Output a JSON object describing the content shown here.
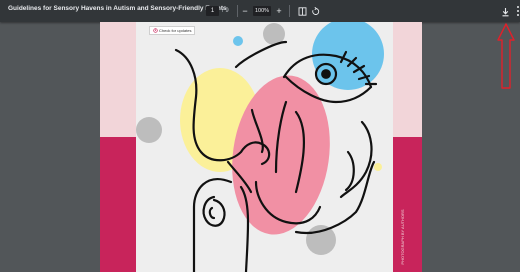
{
  "toolbar": {
    "document_title": "Guidelines for Sensory Havens in Autism and Sensory-Friendly Events",
    "page_current": "1",
    "page_separator": "/",
    "page_total": "9",
    "zoom_out_symbol": "−",
    "zoom_level": "100%",
    "zoom_in_symbol": "+",
    "icons": {
      "fit": "fit-to-page-icon",
      "rotate": "rotate-icon",
      "download": "download-icon",
      "more": "more-vertical-icon"
    }
  },
  "page": {
    "check_updates_label": "Check for updates",
    "side_text": "PHOTOGRAPH BY AUTHORS",
    "colors": {
      "page_band": "#c8245b",
      "page_top": "#f2d5d9",
      "blue_circle": "#6cc4ec",
      "pink_oval": "#f190a4",
      "yellow_oval": "#fbf099",
      "gray_circle": "#bdbdbd"
    }
  },
  "annotation": {
    "color": "#e0202a",
    "icon": "up-arrow-annotation"
  }
}
